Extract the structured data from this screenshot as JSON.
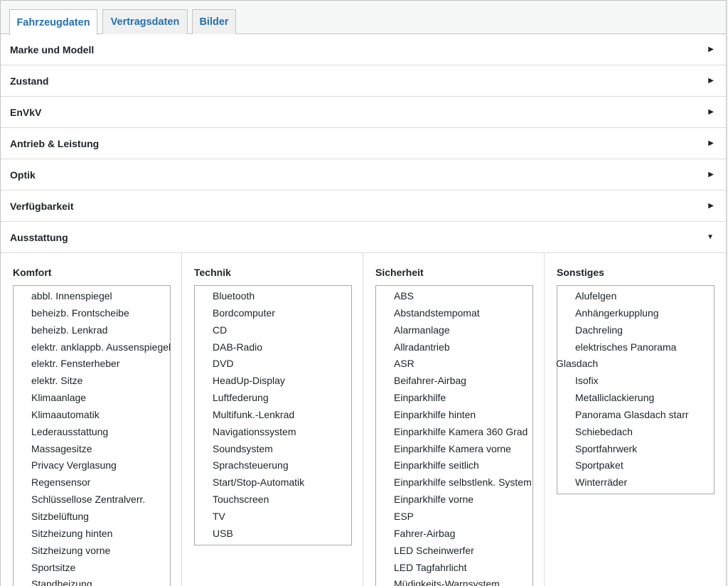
{
  "tabs": [
    {
      "label": "Fahrzeugdaten"
    },
    {
      "label": "Vertragsdaten"
    },
    {
      "label": "Bilder"
    }
  ],
  "sections": [
    {
      "label": "Marke und Modell",
      "arrow": "▶"
    },
    {
      "label": "Zustand",
      "arrow": "▶"
    },
    {
      "label": "EnVkV",
      "arrow": "▶"
    },
    {
      "label": "Antrieb & Leistung",
      "arrow": "▶"
    },
    {
      "label": "Optik",
      "arrow": "▶"
    },
    {
      "label": "Verfügbarkeit",
      "arrow": "▶"
    },
    {
      "label": "Ausstattung",
      "arrow": "▼"
    }
  ],
  "columns": [
    {
      "title": "Komfort",
      "items": [
        "abbl. Innenspiegel",
        "beheizb. Frontscheibe",
        "beheizb. Lenkrad",
        "elektr. anklappb. Aussenspiegel",
        "elektr. Fensterheber",
        "elektr. Sitze",
        "Klimaanlage",
        "Klimaautomatik",
        "Lederausstattung",
        "Massagesitze",
        "Privacy Verglasung",
        "Regensensor",
        "Schlüssellose Zentralverr.",
        "Sitzbelüftung",
        "Sitzheizung hinten",
        "Sitzheizung vorne",
        "Sportsitze",
        "Standheizung"
      ]
    },
    {
      "title": "Technik",
      "items": [
        "Bluetooth",
        "Bordcomputer",
        "CD",
        "DAB-Radio",
        "DVD",
        "HeadUp-Display",
        "Luftfederung",
        "Multifunk.-Lenkrad",
        "Navigationssystem",
        "Soundsystem",
        "Sprachsteuerung",
        "Start/Stop-Automatik",
        "Touchscreen",
        "TV",
        "USB"
      ]
    },
    {
      "title": "Sicherheit",
      "items": [
        "ABS",
        "Abstandstempomat",
        "Alarmanlage",
        "Allradantrieb",
        "ASR",
        "Beifahrer-Airbag",
        "Einparkhilfe",
        "Einparkhilfe hinten",
        "Einparkhilfe Kamera 360 Grad",
        "Einparkhilfe Kamera vorne",
        "Einparkhilfe seitlich",
        "Einparkhilfe selbstlenk. System",
        "Einparkhilfe vorne",
        "ESP",
        "Fahrer-Airbag",
        "LED Scheinwerfer",
        "LED Tagfahrlicht",
        "Müdigkeits-Warnsystem"
      ]
    },
    {
      "title": "Sonstiges",
      "items": [
        "Alufelgen",
        "Anhängerkupplung",
        "Dachreling",
        "elektrisches Panorama",
        "Glasdach",
        "Isofix",
        "Metalliclackierung",
        "Panorama Glasdach starr",
        "Schiebedach",
        "Sportfahrwerk",
        "Sportpaket",
        "Winterräder"
      ]
    }
  ]
}
